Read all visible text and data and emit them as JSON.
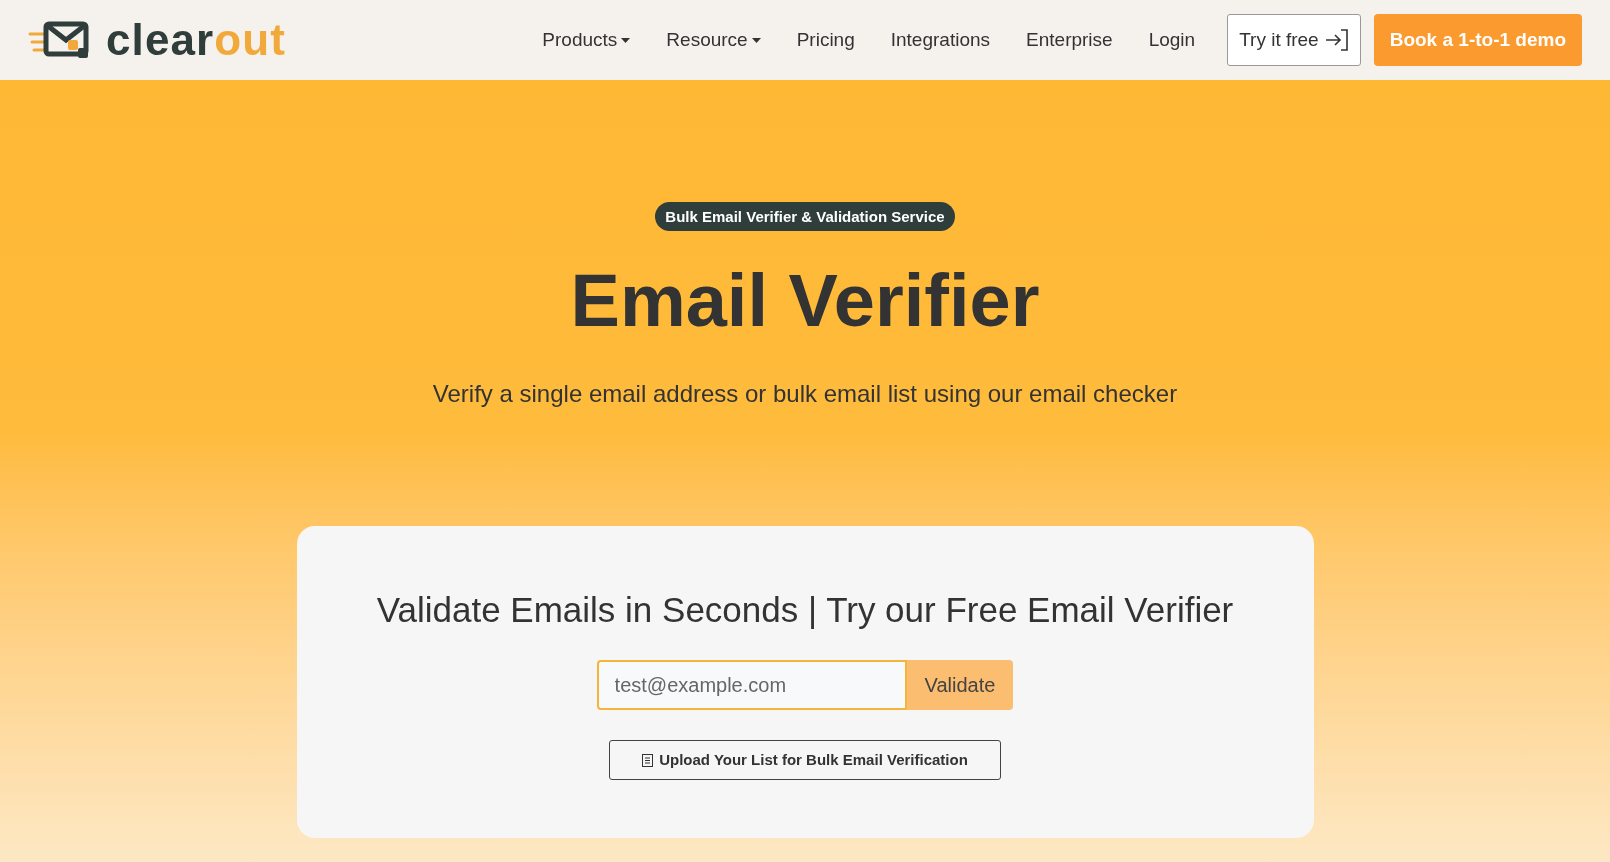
{
  "logo": {
    "text_dark": "clear",
    "text_accent": "out"
  },
  "nav": {
    "items": [
      {
        "label": "Products",
        "dropdown": true
      },
      {
        "label": "Resource",
        "dropdown": true
      },
      {
        "label": "Pricing",
        "dropdown": false
      },
      {
        "label": "Integrations",
        "dropdown": false
      },
      {
        "label": "Enterprise",
        "dropdown": false
      },
      {
        "label": "Login",
        "dropdown": false
      }
    ],
    "try_button": "Try it free",
    "demo_button": "Book a 1-to-1 demo"
  },
  "hero": {
    "badge": "Bulk Email Verifier & Validation Service",
    "title": "Email Verifier",
    "subtitle": "Verify a single email address or bulk email list using our email checker"
  },
  "card": {
    "title": "Validate Emails in Seconds | Try our Free Email Verifier",
    "email_field": {
      "placeholder": "test@example.com"
    },
    "validate_button": "Validate",
    "upload_button": "Upload Your List for Bulk Email Verification"
  }
}
